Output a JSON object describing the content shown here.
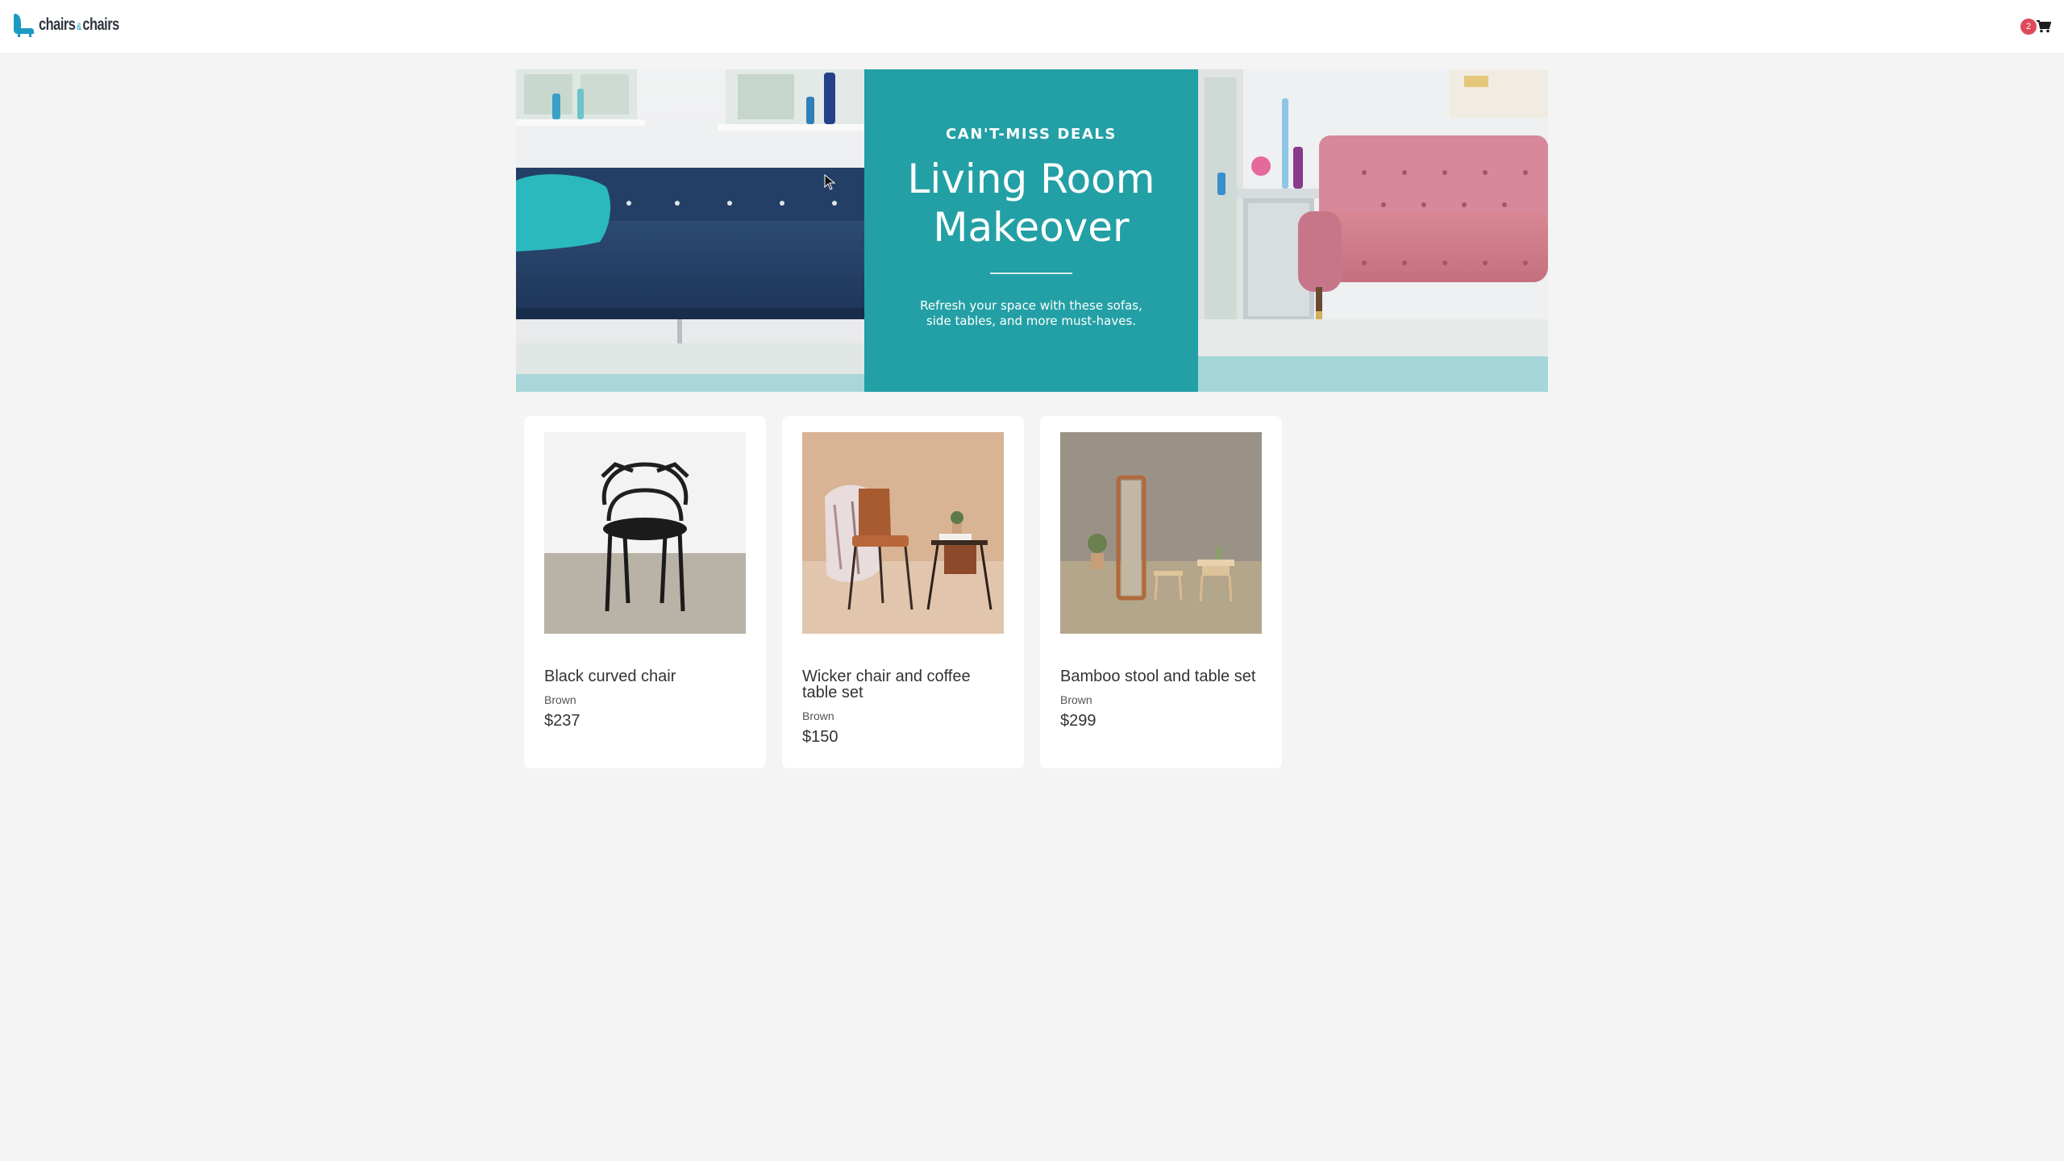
{
  "header": {
    "logo_text_left": "chairs",
    "logo_text_amp": "&",
    "logo_text_right": "chairs",
    "cart": {
      "count": "2",
      "icon": "shopping-cart-icon"
    }
  },
  "banner": {
    "kicker": "CAN'T-MISS DEALS",
    "headline_line1": "Living Room",
    "headline_line2": "Makeover",
    "subtext_line1": "Refresh your space with these sofas,",
    "subtext_line2": "side tables, and more must-haves.",
    "colors": {
      "panel": "#23a0a5"
    }
  },
  "products": [
    {
      "name": "Black curved chair",
      "color": "Brown",
      "price": "$237"
    },
    {
      "name": "Wicker chair and coffee table set",
      "color": "Brown",
      "price": "$150"
    },
    {
      "name": "Bamboo stool and table set",
      "color": "Brown",
      "price": "$299"
    }
  ],
  "colors": {
    "accent": "#23a0a5",
    "badge": "#e0495a",
    "background": "#f4f4f4"
  }
}
